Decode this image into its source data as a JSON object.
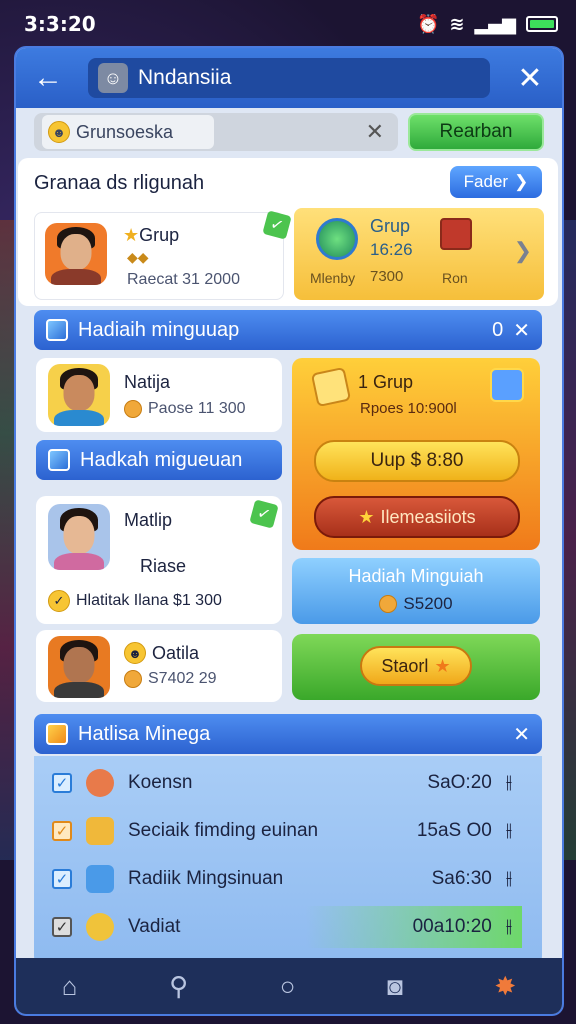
{
  "status_bar": {
    "time": "3:3:20"
  },
  "topbar": {
    "title": "Nndansiia"
  },
  "search": {
    "chip_text": "Grunsoeska",
    "button": "Rearban"
  },
  "section1": {
    "title": "Granaa ds rligunah",
    "more_button": "Fader",
    "profile": {
      "name": "Grup",
      "sub": "Raecat 31 2000"
    },
    "promo": {
      "title": "Grup",
      "time": "16:26",
      "label1": "Mlenby",
      "value": "7300",
      "label2": "Ron"
    }
  },
  "section2": {
    "title": "Hadiaih minguuap",
    "count": "0",
    "left_cards": [
      {
        "name": "Natija",
        "sub": "Paose 11 300"
      },
      {
        "name": "Matlip",
        "sub": "Riase",
        "footer": "Hlatitak Ilana $1 300"
      },
      {
        "name": "Oatila",
        "sub": "S7402 29"
      }
    ],
    "sub_header": "Hadkah migueuan",
    "orange_card": {
      "title": "1 Grup",
      "subtitle": "Rpoes 10:900l",
      "btn1": "Uup $ 8:80",
      "btn2": "Ilemeasiiots"
    },
    "blue_card": {
      "title": "Hadiah Minguiah",
      "value": "S5200"
    },
    "green_card": {
      "button": "Staorl"
    }
  },
  "section3": {
    "title": "Hatlisa Minega",
    "rows": [
      {
        "label": "Koensn",
        "value": "SaO:20"
      },
      {
        "label": "Seciaik fimding euinan",
        "value": "15aS O0"
      },
      {
        "label": "Radiik Mingsinuan",
        "value": "Sa6:30"
      },
      {
        "label": "Vadiat",
        "value": "00a10:20"
      }
    ]
  },
  "colors": {
    "primary": "#2c62d0",
    "accent_orange": "#f39a1e",
    "accent_green": "#4cb848"
  }
}
